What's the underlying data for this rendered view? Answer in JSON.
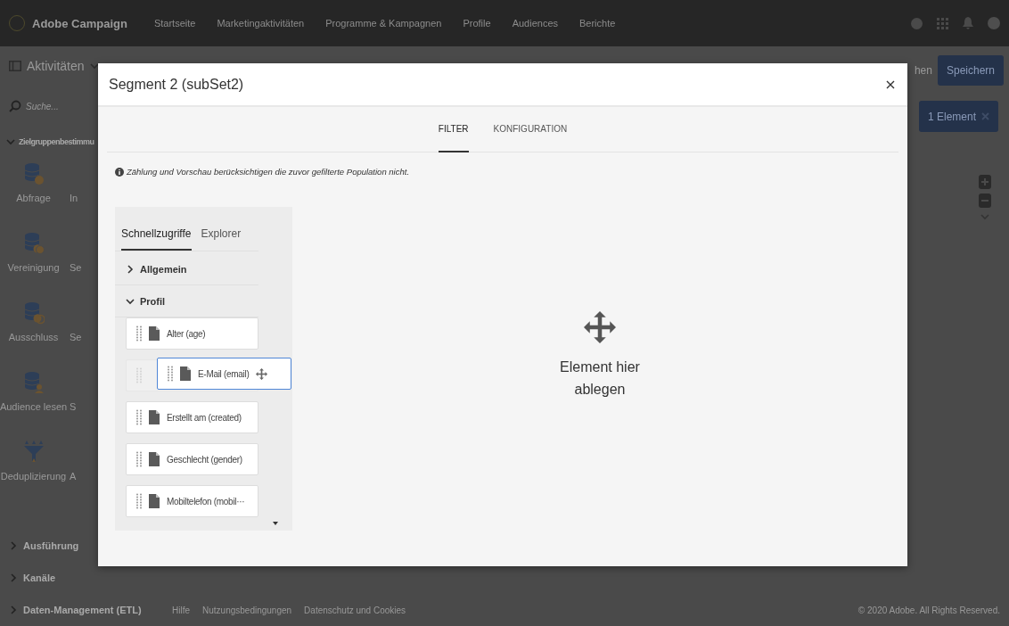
{
  "top_bar": {
    "product": "Adobe Campaign",
    "nav": [
      "Startseite",
      "Marketingaktivitäten",
      "Programme & Kampagnen",
      "Profile",
      "Audiences",
      "Berichte"
    ]
  },
  "sidebar": {
    "title": "Aktivitäten",
    "search": {
      "placeholder": "Suche..."
    },
    "sections": [
      {
        "label": "Zielgruppenbestimmu",
        "expanded": true,
        "activities": [
          {
            "label": "Abfrage",
            "kind": "query",
            "column_2": "In"
          },
          {
            "label": "Vereinigung",
            "kind": "union",
            "column_2": "Se"
          },
          {
            "label": "Ausschluss",
            "kind": "exclusion",
            "column_2": "Se"
          },
          {
            "label": "Audience lesen",
            "kind": "audience",
            "column_2": "S"
          },
          {
            "label": "Deduplizierung",
            "kind": "dedup",
            "column_2": "A"
          }
        ]
      },
      {
        "label": "Ausführung",
        "expanded": false
      },
      {
        "label": "Kanäle",
        "expanded": false
      },
      {
        "label": "Daten-Management (ETL)",
        "expanded": false
      }
    ]
  },
  "toolbar": {
    "search_fragment": "hen",
    "save_button": "Speichern",
    "selection_chip": "1 Element"
  },
  "footer": {
    "links": [
      "Hilfe",
      "Nutzungsbedingungen",
      "Datenschutz und Cookies"
    ],
    "copyright": "© 2020 Adobe. All Rights Reserved."
  },
  "dialog": {
    "title": "Segment 2 (subSet2)",
    "tabs": [
      {
        "label": "FILTER",
        "selected": true
      },
      {
        "label": "KONFIGURATION",
        "selected": false
      }
    ],
    "notice": "Zählung und Vorschau berücksichtigen die zuvor gefilterte Population nicht.",
    "palette": {
      "tabs": [
        {
          "label": "Schnellzugriffe",
          "selected": true
        },
        {
          "label": "Explorer",
          "selected": false
        }
      ],
      "groups": [
        {
          "label": "Allgemein",
          "expanded": false
        },
        {
          "label": "Profil",
          "expanded": true,
          "fields": [
            {
              "label": "Alter (age)",
              "dragging": false
            },
            {
              "label": "E-Mail (email)",
              "dragging": true
            },
            {
              "label": "Erstellt am (created)",
              "dragging": false
            },
            {
              "label": "Geschlecht (gender)",
              "dragging": false
            },
            {
              "label": "Mobiltelefon (mobil···",
              "dragging": false
            }
          ]
        }
      ]
    },
    "drop_zone": {
      "text": "Element hier ablegen"
    }
  }
}
